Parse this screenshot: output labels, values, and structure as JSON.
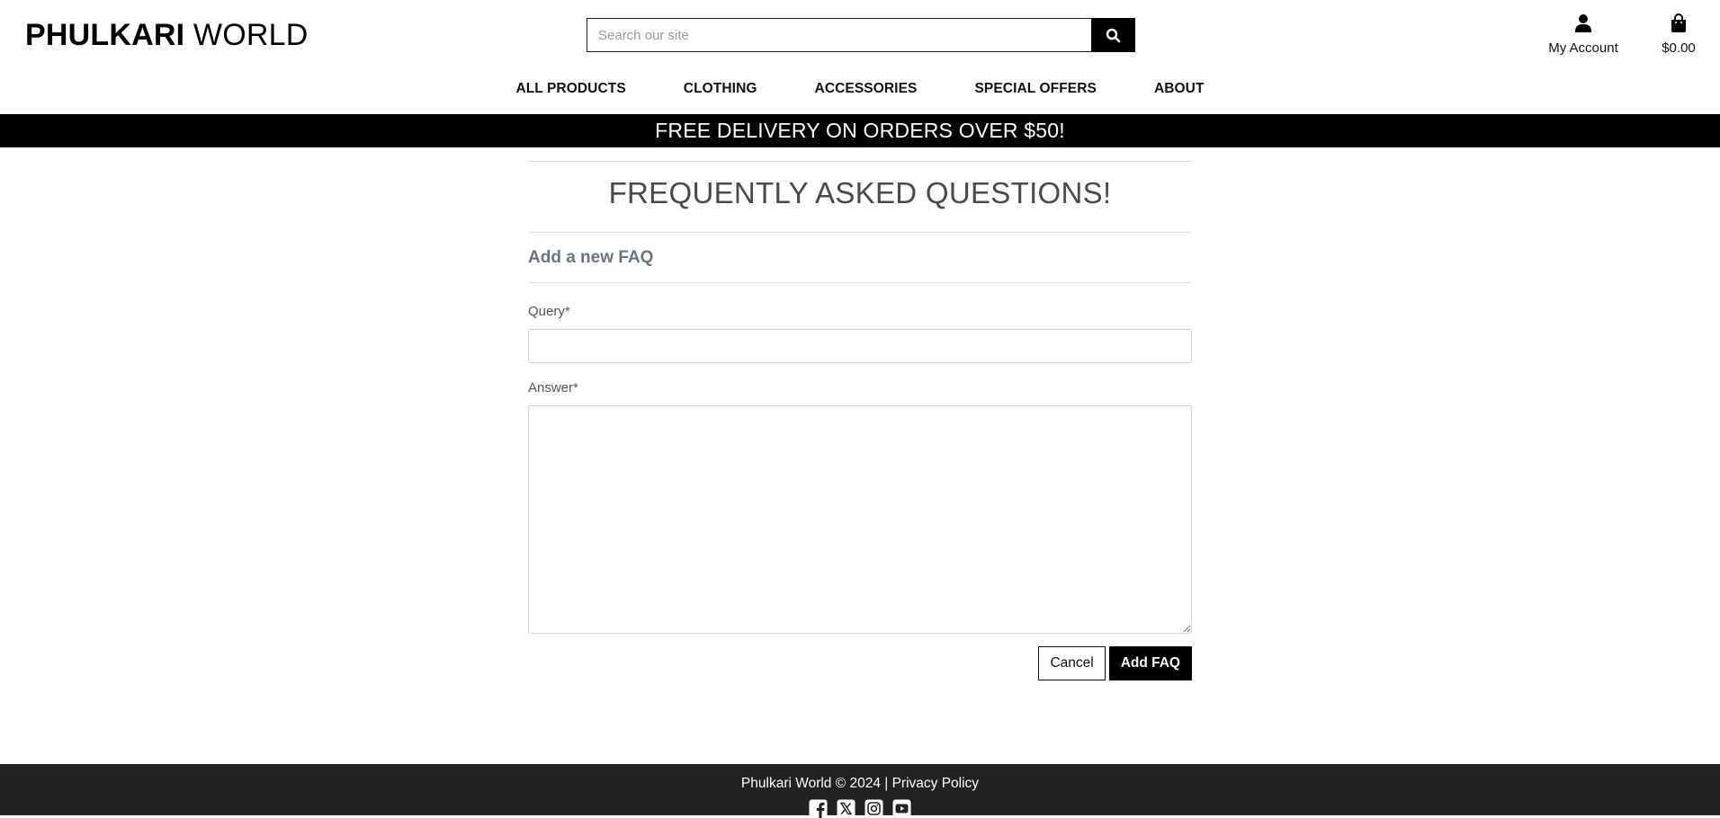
{
  "brand": {
    "name_bold": "PHULKARI",
    "name_light": "WORLD"
  },
  "search": {
    "placeholder": "Search our site",
    "value": ""
  },
  "header": {
    "account_label": "My Account",
    "bag_total": "$0.00"
  },
  "nav": {
    "items": [
      {
        "label": "ALL PRODUCTS"
      },
      {
        "label": "CLOTHING"
      },
      {
        "label": "ACCESSORIES"
      },
      {
        "label": "SPECIAL OFFERS"
      },
      {
        "label": "ABOUT"
      }
    ]
  },
  "banner": {
    "text": "FREE DELIVERY ON ORDERS OVER $50!"
  },
  "main": {
    "title": "FREQUENTLY ASKED QUESTIONS!",
    "subtitle": "Add a new FAQ",
    "form": {
      "query_label": "Query*",
      "query_value": "",
      "answer_label": "Answer*",
      "answer_value": "",
      "cancel_label": "Cancel",
      "submit_label": "Add FAQ"
    }
  },
  "footer": {
    "copyright": "Phulkari World © 2024 |",
    "privacy_label": "Privacy Policy",
    "socials": [
      {
        "icon": "facebook-icon"
      },
      {
        "icon": "x-twitter-icon"
      },
      {
        "icon": "instagram-icon"
      },
      {
        "icon": "youtube-icon"
      }
    ]
  },
  "colors": {
    "brand_black": "#000000",
    "footer_bg": "#222222",
    "muted_text": "#6c757d",
    "border": "#ced4da"
  }
}
